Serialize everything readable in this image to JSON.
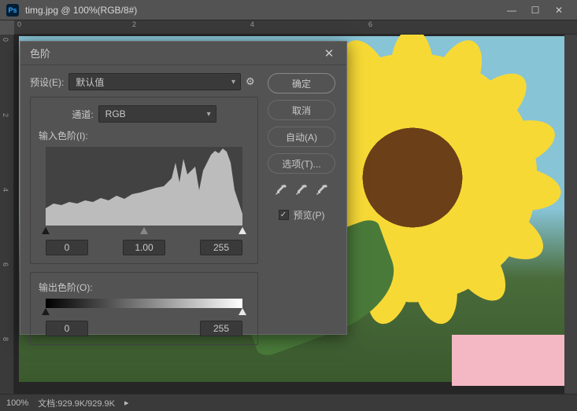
{
  "titlebar": {
    "ps": "Ps",
    "text": "timg.jpg @ 100%(RGB/8#)"
  },
  "ruler_h": [
    "0",
    "2",
    "4",
    "6"
  ],
  "ruler_v": [
    "0",
    "2",
    "4",
    "6",
    "8"
  ],
  "statusbar": {
    "zoom": "100%",
    "doc_label": "文档:",
    "doc_size": "929.9K/929.9K"
  },
  "dialog": {
    "title": "色阶",
    "preset_label": "预设(E):",
    "preset_value": "默认值",
    "channel_label": "通道:",
    "channel_value": "RGB",
    "input_label": "输入色阶(I):",
    "input_vals": {
      "black": "0",
      "mid": "1.00",
      "white": "255"
    },
    "output_label": "输出色阶(O):",
    "output_vals": {
      "black": "0",
      "white": "255"
    },
    "buttons": {
      "ok": "确定",
      "cancel": "取消",
      "auto": "自动(A)",
      "options": "选项(T)..."
    },
    "preview_label": "预览(P)",
    "preview_checked": true
  }
}
